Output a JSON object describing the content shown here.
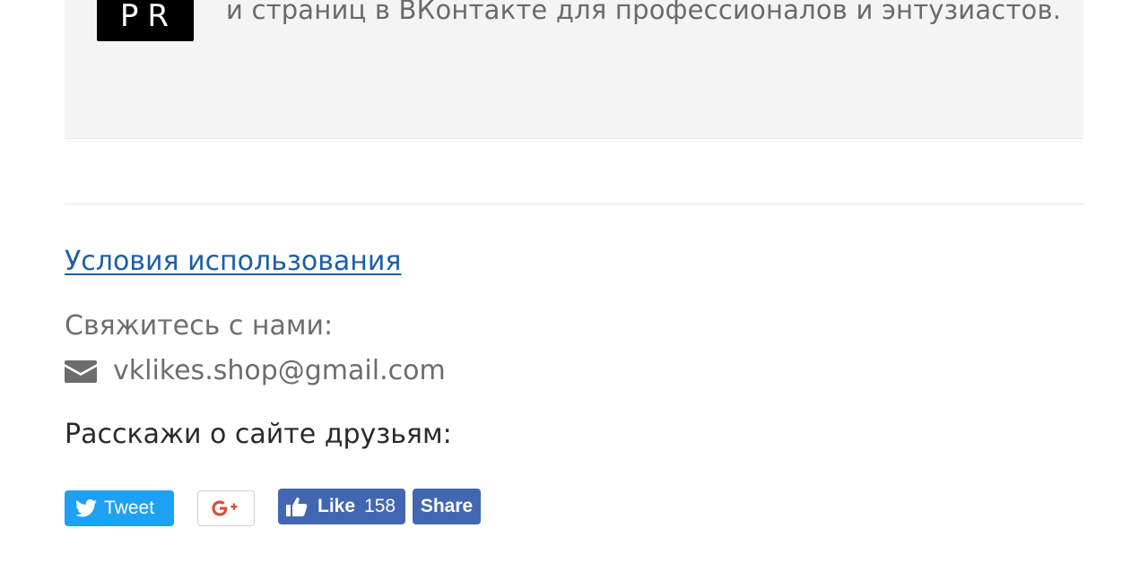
{
  "info": {
    "logo_text": "PR",
    "text": "и страниц в ВКонтакте для профессионалов и энтузиастов."
  },
  "footer": {
    "terms_link": "Условия использования",
    "contact_label": "Свяжитесь с нами:",
    "email": "vklikes.shop@gmail.com",
    "email_icon": "envelope-icon",
    "share_label": "Расскажи о сайте друзьям:"
  },
  "social": {
    "tweet_label": "Tweet",
    "gplus_label": "G+",
    "like_label": "Like",
    "like_count": "158",
    "share_label": "Share",
    "colors": {
      "twitter": "#1da1f2",
      "facebook": "#4267b2",
      "gplus": "#dd4b39",
      "link": "#1b5ea8"
    }
  }
}
